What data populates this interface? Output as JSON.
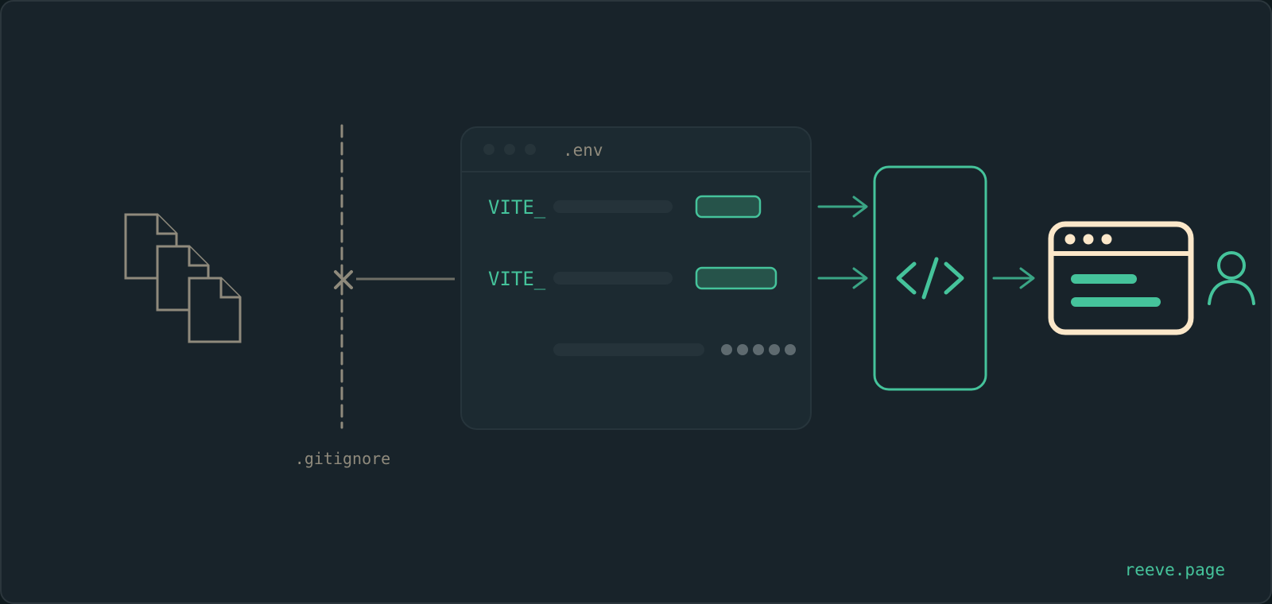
{
  "colors": {
    "background": "#18232a",
    "border": "#2b363c",
    "muted": "#8f8a7c",
    "accent": "#45c39b",
    "accent_fill": "#26534a",
    "panel": "#1c2a31",
    "panel_border": "#27353c",
    "placeholder_bar": "#25333a",
    "dots": "#5e6a6f",
    "browser_cream": "#fbe7c9"
  },
  "icons": {
    "files": "stacked-files-icon",
    "blocked": "x-mark-icon",
    "code": "code-brackets-icon",
    "browser": "browser-window-icon",
    "user": "user-icon"
  },
  "gitignore": {
    "label": ".gitignore"
  },
  "env_file": {
    "title": ".env",
    "rows": [
      {
        "prefix": "VITE_"
      },
      {
        "prefix": "VITE_"
      },
      {
        "prefix": ""
      }
    ]
  },
  "footer": {
    "brand": "reeve.page"
  }
}
